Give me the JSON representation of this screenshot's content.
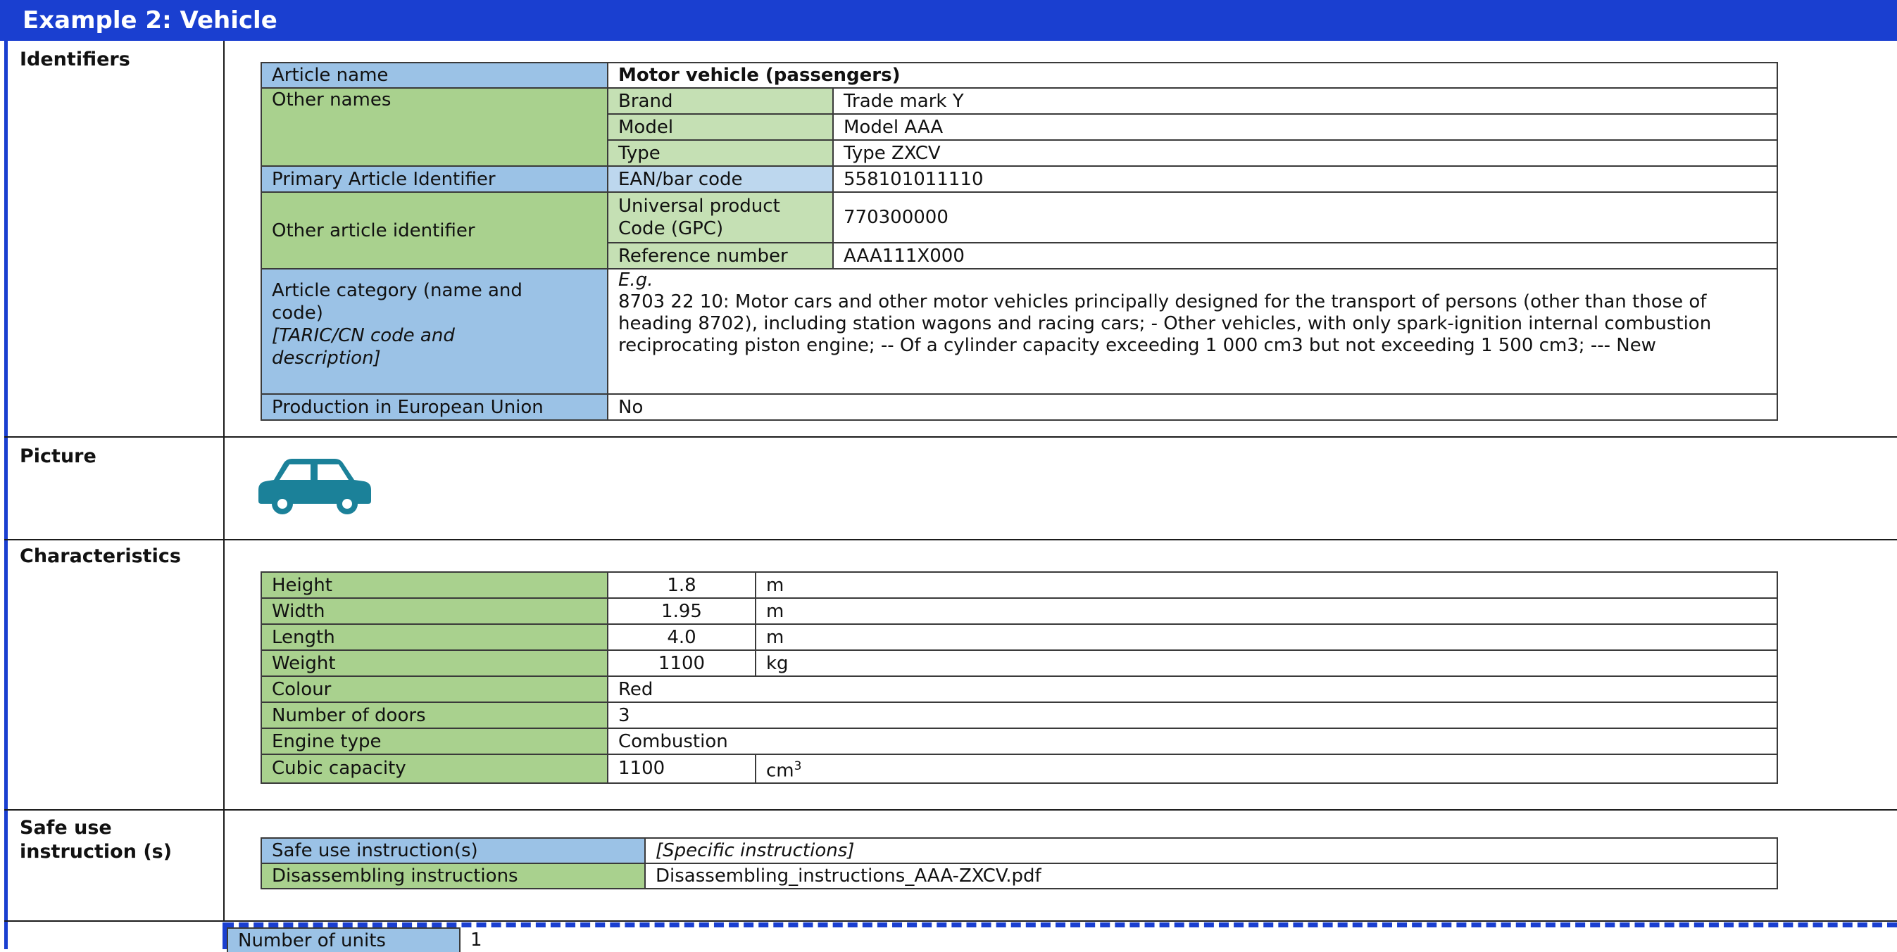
{
  "title": "Example 2: Vehicle",
  "sections": {
    "identifiers": "Identifiers",
    "picture": "Picture",
    "characteristics": "Characteristics",
    "safe_use_line1": "Safe use",
    "safe_use_line2": "instruction (s)"
  },
  "identifiers": {
    "article_name_label": "Article name",
    "article_name_value": "Motor vehicle (passengers)",
    "other_names_label": "Other names",
    "brand_label": "Brand",
    "brand_value": "Trade mark Y",
    "model_label": "Model",
    "model_value": "Model AAA",
    "type_label": "Type",
    "type_value": "Type ZXCV",
    "primary_id_label": "Primary Article Identifier",
    "ean_label": "EAN/bar code",
    "ean_value": "558101011110",
    "other_id_label": "Other article identifier",
    "upc_label_line1": "Universal product",
    "upc_label_line2": "Code (GPC)",
    "upc_value": "770300000",
    "ref_label": "Reference number",
    "ref_value": "AAA111X000",
    "category_label_line1": "Article category (name and",
    "category_label_line2": "code)",
    "category_label_line3": "[TARIC/CN code and",
    "category_label_line4": "description]",
    "category_eg": "E.g.",
    "category_text": "8703 22 10: Motor cars and other motor vehicles principally designed for the transport of persons (other than those of heading 8702), including station wagons and racing cars; - Other vehicles, with only spark-ignition internal combustion reciprocating piston engine; -- Of a cylinder capacity exceeding 1 000 cm3 but not exceeding 1 500 cm3; --- New",
    "production_label": "Production in European Union",
    "production_value": "No"
  },
  "picture": {
    "icon": "car-icon",
    "color": "#1b8199"
  },
  "characteristics": [
    {
      "label": "Height",
      "value": "1.8",
      "unit": "m"
    },
    {
      "label": "Width",
      "value": "1.95",
      "unit": "m"
    },
    {
      "label": "Length",
      "value": "4.0",
      "unit": "m"
    },
    {
      "label": "Weight",
      "value": "1100",
      "unit": "kg"
    },
    {
      "label": "Colour",
      "value": "Red"
    },
    {
      "label": "Number of doors",
      "value": "3"
    },
    {
      "label": "Engine type",
      "value": "Combustion"
    },
    {
      "label": "Cubic capacity",
      "value": "1100",
      "unit": "cm",
      "unit_sup": "3"
    }
  ],
  "safe_use": {
    "instructions_label": "Safe use instruction(s)",
    "instructions_value": "[Specific instructions]",
    "disassembling_label": "Disassembling instructions",
    "disassembling_value": "Disassembling_instructions_AAA-ZXCV.pdf"
  },
  "units": {
    "label": "Number of units",
    "value": "1"
  },
  "colors": {
    "header_blue": "#1a3fd0",
    "cell_blue": "#9bc2e6",
    "cell_green": "#a9d18e"
  }
}
